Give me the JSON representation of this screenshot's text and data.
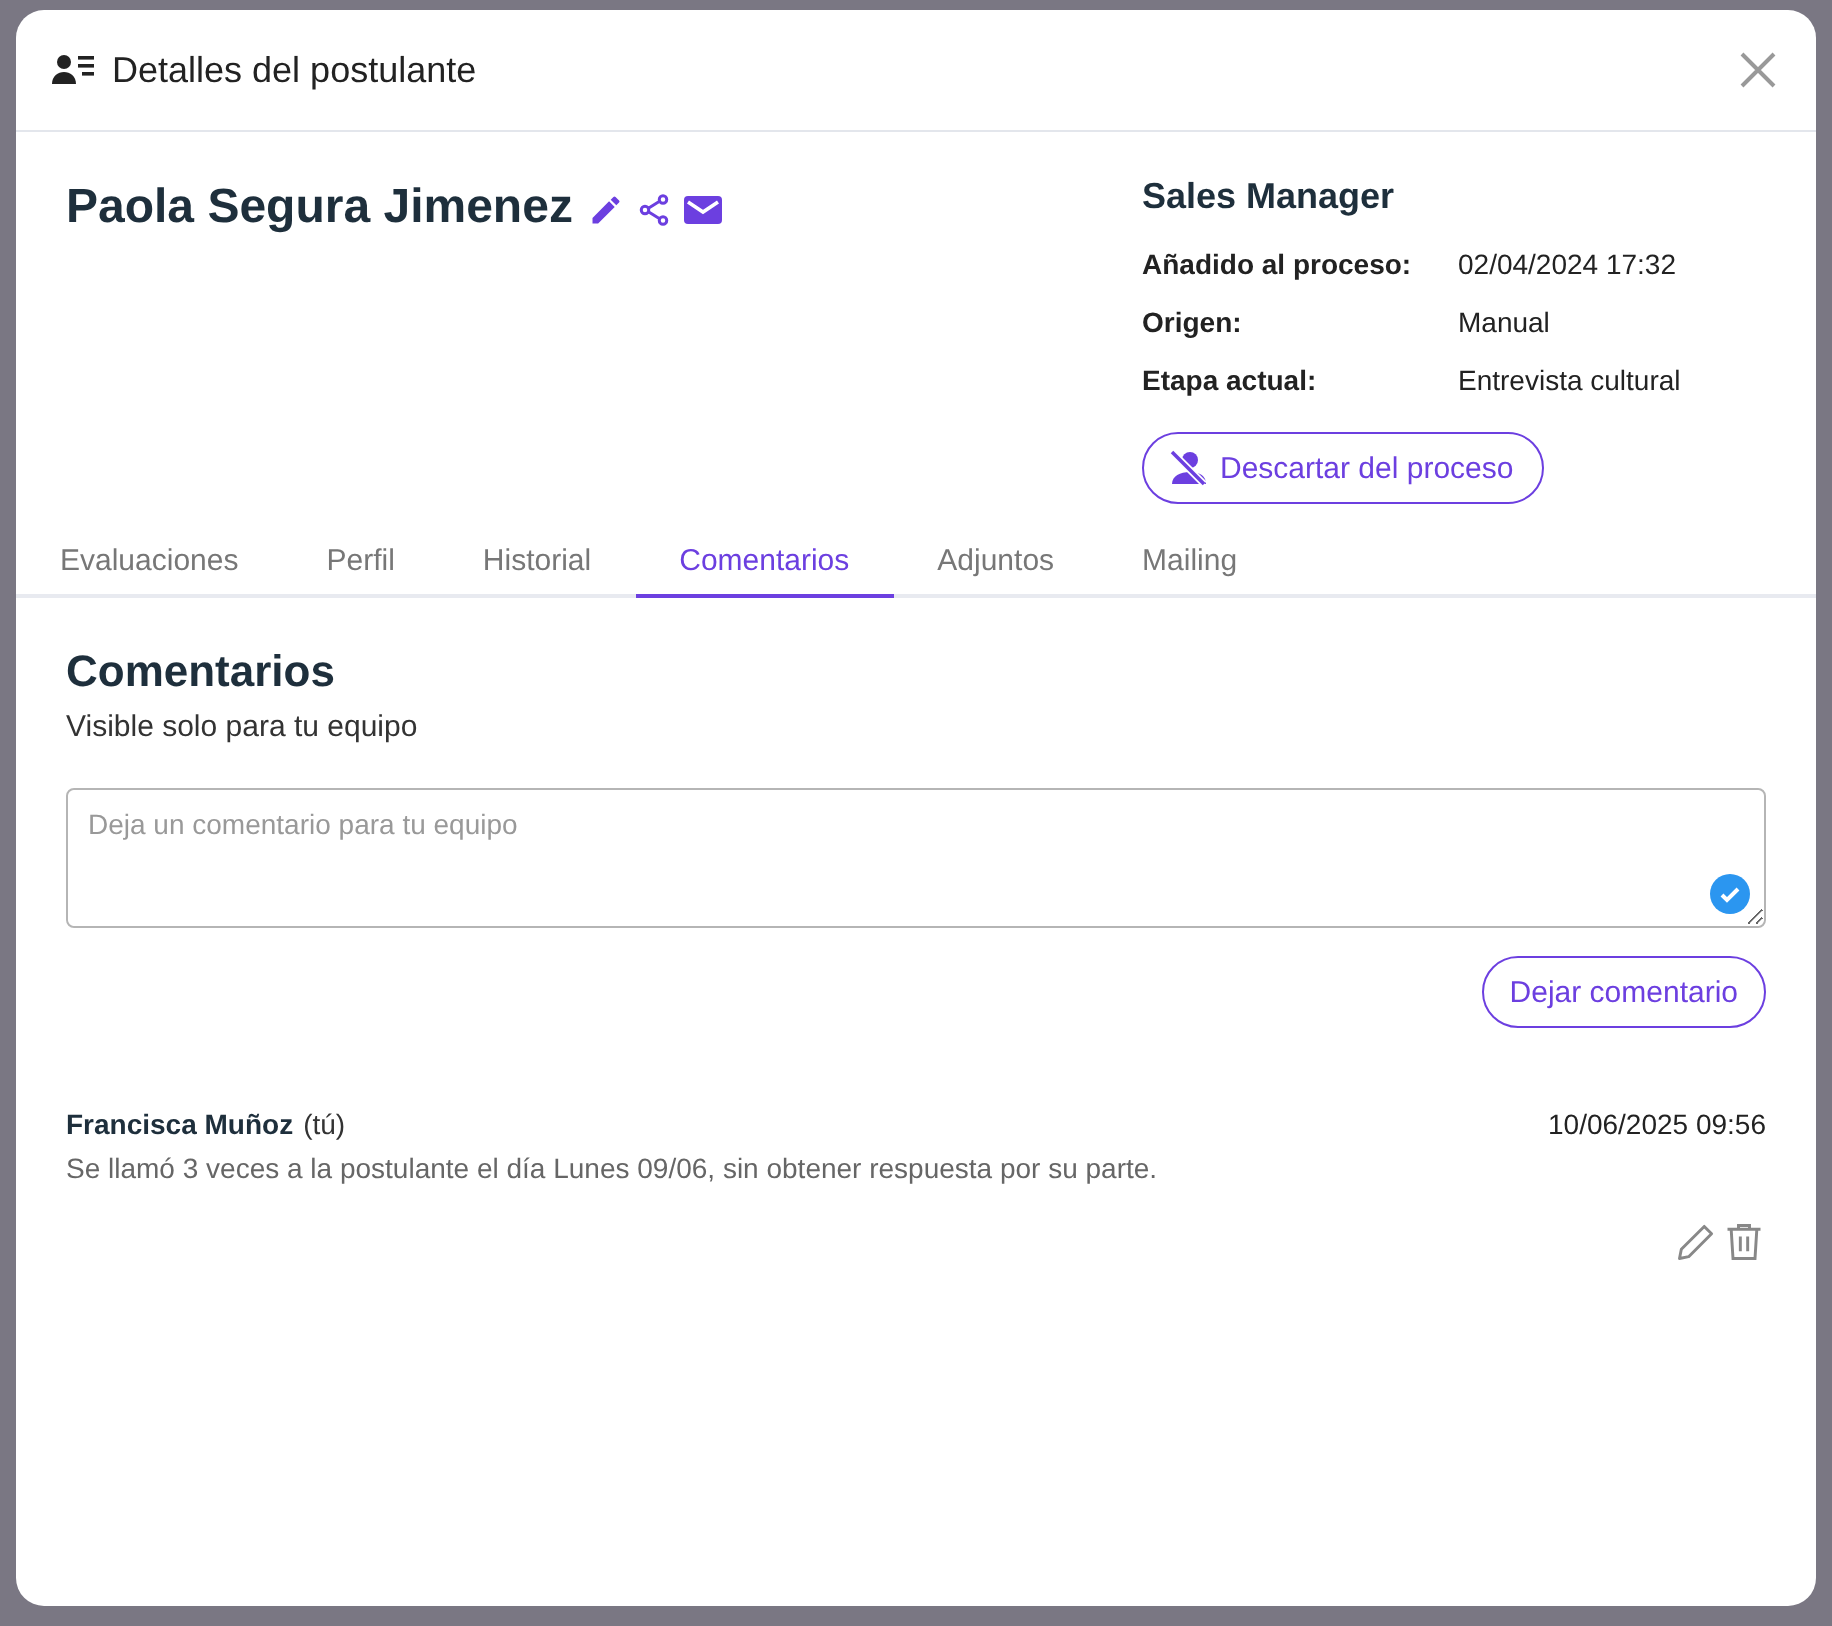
{
  "dialog": {
    "title": "Detalles del postulante"
  },
  "candidate": {
    "name": "Paola Segura Jimenez"
  },
  "process": {
    "position": "Sales Manager",
    "details": [
      {
        "label": "Añadido al proceso:",
        "value": "02/04/2024 17:32"
      },
      {
        "label": "Origen:",
        "value": "Manual"
      },
      {
        "label": "Etapa actual:",
        "value": "Entrevista cultural"
      }
    ],
    "discard_button": "Descartar del proceso"
  },
  "tabs": [
    {
      "label": "Evaluaciones",
      "selected": false
    },
    {
      "label": "Perfil",
      "selected": false
    },
    {
      "label": "Historial",
      "selected": false
    },
    {
      "label": "Comentarios",
      "selected": true
    },
    {
      "label": "Adjuntos",
      "selected": false
    },
    {
      "label": "Mailing",
      "selected": false
    }
  ],
  "comments_section": {
    "heading": "Comentarios",
    "subtitle": "Visible solo para tu equipo",
    "placeholder": "Deja un comentario para tu equipo",
    "submit_button": "Dejar comentario"
  },
  "comments": [
    {
      "author": "Francisca Muñoz",
      "author_note": "(tú)",
      "timestamp": "10/06/2025 09:56",
      "text": "Se llamó 3 veces a la postulante el día Lunes 09/06, sin obtener respuesta por su parte."
    }
  ]
}
